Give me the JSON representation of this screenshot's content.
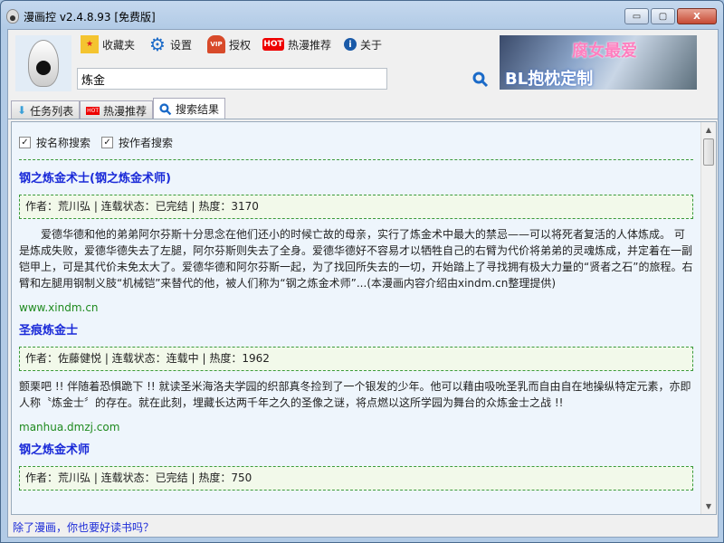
{
  "window": {
    "title": "漫画控 v2.4.8.93 [免费版]",
    "min": "▭",
    "max": "▢",
    "close": "X"
  },
  "toolbar": {
    "favorites": "收藏夹",
    "settings": "设置",
    "auth": "授权",
    "hot": "热漫推荐",
    "about": "关于",
    "hot_badge": "HOT",
    "vip_badge": "VIP"
  },
  "search": {
    "value": "炼金"
  },
  "banner": {
    "line1": "腐女最爱",
    "line2": "BL抱枕定制"
  },
  "tabs": [
    {
      "label": "任务列表"
    },
    {
      "label": "热漫推荐"
    },
    {
      "label": "搜索结果"
    }
  ],
  "options": {
    "by_name": "按名称搜索",
    "by_author": "按作者搜索",
    "check": "✓"
  },
  "results": [
    {
      "title": "钢之炼金术士(钢之炼金术师)",
      "info": "作者：荒川弘 | 连载状态：已完结 | 热度：3170",
      "desc": "　　爱德华德和他的弟弟阿尔芬斯十分思念在他们还小的时候亡故的母亲，实行了炼金术中最大的禁忌——可以将死者复活的人体炼成。 可是炼成失败，爱德华德失去了左腿，阿尔芬斯则失去了全身。爱德华德好不容易才以牺牲自己的右臂为代价将弟弟的灵魂炼成，并定着在一副铠甲上，可是其代价未免太大了。爱德华德和阿尔芬斯一起，为了找回所失去的一切，开始踏上了寻找拥有极大力量的“贤者之石”的旅程。右臂和左腿用钢制义肢“机械铠”来替代的他，被人们称为“钢之炼金术师”...(本漫画内容介绍由xindm.cn整理提供)",
      "url": "www.xindm.cn"
    },
    {
      "title": "圣痕炼金士",
      "info": "作者：佐藤健悦 | 连载状态：连载中 | 热度：1962",
      "desc": "颤栗吧 !! 伴随着恐惧跪下 !! 就读圣米海洛夫学园的织部真冬捡到了一个银发的少年。他可以藉由吸吮圣乳而自由自在地操纵特定元素，亦即人称〝炼金士〞的存在。就在此刻，埋藏长达两千年之久的圣像之谜，将点燃以这所学园为舞台的众炼金士之战 !!",
      "url": "manhua.dmzj.com"
    },
    {
      "title": "钢之炼金术师",
      "info": "作者：荒川弘 | 连载状态：已完结 | 热度：750"
    }
  ],
  "status": {
    "link": "除了漫画，你也要好读书吗？"
  }
}
